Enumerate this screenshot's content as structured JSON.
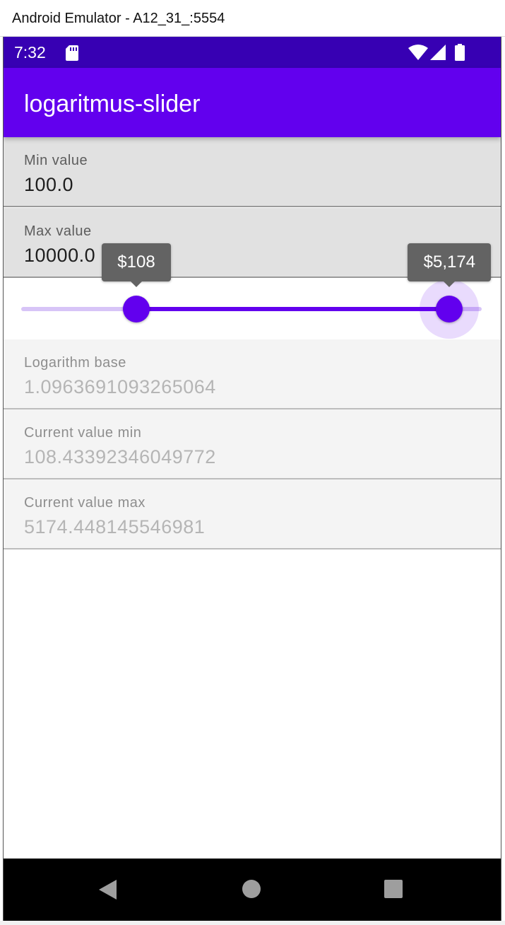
{
  "window": {
    "title": "Android Emulator - A12_31_:5554"
  },
  "status_bar": {
    "time": "7:32",
    "icons": [
      "sd-card-icon",
      "wifi-icon",
      "signal-icon",
      "battery-icon"
    ],
    "background": "#3700b3"
  },
  "app_bar": {
    "title": "logaritmus-slider",
    "background": "#6200ee"
  },
  "fields": {
    "min_value": {
      "label": "Min value",
      "value": "100.0"
    },
    "max_value": {
      "label": "Max value",
      "value": "10000.0"
    },
    "log_base": {
      "label": "Logarithm base",
      "value": "1.0963691093265064"
    },
    "current_min": {
      "label": "Current value min",
      "value": "108.43392346049772"
    },
    "current_max": {
      "label": "Current value max",
      "value": "5174.448145546981"
    }
  },
  "range_slider": {
    "min": 0,
    "max": 100,
    "start": 25,
    "end": 93,
    "start_label": "$108",
    "end_label": "$5,174",
    "active_color": "#6200ee",
    "inactive_color": "#d7c4f7"
  },
  "nav_bar": {
    "buttons": [
      "back-icon",
      "home-icon",
      "recents-icon"
    ]
  }
}
